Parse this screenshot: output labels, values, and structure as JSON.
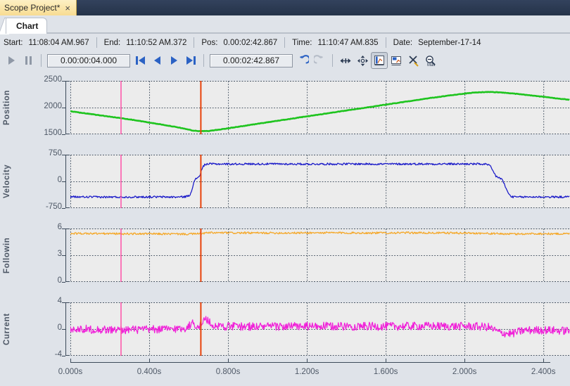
{
  "window": {
    "document_tab": "Scope Project*",
    "close_glyph": "×",
    "chart_tab": "Chart"
  },
  "info": {
    "start_label": "Start:",
    "start_value": "11:08:04 AM.967",
    "end_label": "End:",
    "end_value": "11:10:52 AM.372",
    "pos_label": "Pos:",
    "pos_value": "0.00:02:42.867",
    "time_label": "Time:",
    "time_value": "11:10:47 AM.835",
    "date_label": "Date:",
    "date_value": "September-17-14"
  },
  "toolbar": {
    "play": "play-button",
    "pause": "pause-button",
    "duration_value": "0.00:00:04.000",
    "skip_start": "skip-to-start-button",
    "step_back": "step-back-button",
    "step_forward": "step-forward-button",
    "skip_end": "skip-to-end-button",
    "position_value": "0.00:02:42.867",
    "undo": "undo-button",
    "redo": "redo-button",
    "fit_horizontal": "fit-horizontal-button",
    "pan": "pan-button",
    "cursor_mode_1": "chart-cursor-1-button",
    "cursor_mode_2": "chart-cursor-2-button",
    "clear_cursors": "clear-cursors-button",
    "zoom_max": "zoom-max-button",
    "accent": "#2b62c4"
  },
  "chart_data": {
    "type": "line",
    "title": "Chart",
    "xlabel": "",
    "x_unit": "s",
    "xlim": [
      0.0,
      2.535
    ],
    "xticks": [
      0.0,
      0.4,
      0.8,
      1.2,
      1.6,
      2.0,
      2.4
    ],
    "xticklabels": [
      "0.000s",
      "0.400s",
      "0.800s",
      "1.200s",
      "1.600s",
      "2.000s",
      "2.400s"
    ],
    "grid": true,
    "legend": "none",
    "cursors": [
      {
        "name": "cursor-1",
        "x": 0.257,
        "color": "#ff50a8"
      },
      {
        "name": "cursor-2",
        "x": 0.662,
        "color": "#e8420a"
      }
    ],
    "panels": [
      {
        "name": "position",
        "ylabel": "Position",
        "ylim": [
          1500,
          2500
        ],
        "yticks": [
          1500,
          2000,
          2500
        ],
        "yticklabels": [
          "1500",
          "2000",
          "2500"
        ],
        "color": "#1fc41f",
        "noise": 4,
        "points": [
          [
            0.0,
            1930
          ],
          [
            0.1,
            1880
          ],
          [
            0.2,
            1830
          ],
          [
            0.3,
            1780
          ],
          [
            0.4,
            1720
          ],
          [
            0.5,
            1660
          ],
          [
            0.58,
            1605
          ],
          [
            0.62,
            1570
          ],
          [
            0.66,
            1558
          ],
          [
            0.7,
            1562
          ],
          [
            0.75,
            1585
          ],
          [
            0.85,
            1640
          ],
          [
            1.0,
            1725
          ],
          [
            1.2,
            1835
          ],
          [
            1.4,
            1945
          ],
          [
            1.6,
            2055
          ],
          [
            1.8,
            2165
          ],
          [
            1.95,
            2240
          ],
          [
            2.05,
            2282
          ],
          [
            2.12,
            2292
          ],
          [
            2.18,
            2285
          ],
          [
            2.25,
            2262
          ],
          [
            2.35,
            2222
          ],
          [
            2.45,
            2180
          ],
          [
            2.535,
            2145
          ]
        ]
      },
      {
        "name": "velocity",
        "ylabel": "Velocity",
        "ylim": [
          -750,
          750
        ],
        "yticks": [
          -750,
          0,
          750
        ],
        "yticklabels": [
          "-750",
          "0",
          "750"
        ],
        "color": "#1818c8",
        "noise": 28,
        "points": [
          [
            0.0,
            -435
          ],
          [
            0.2,
            -440
          ],
          [
            0.4,
            -435
          ],
          [
            0.55,
            -440
          ],
          [
            0.58,
            -430
          ],
          [
            0.605,
            -400
          ],
          [
            0.615,
            -250
          ],
          [
            0.625,
            -60
          ],
          [
            0.635,
            60
          ],
          [
            0.645,
            110
          ],
          [
            0.655,
            150
          ],
          [
            0.665,
            300
          ],
          [
            0.675,
            430
          ],
          [
            0.685,
            480
          ],
          [
            0.7,
            490
          ],
          [
            0.8,
            488
          ],
          [
            1.0,
            490
          ],
          [
            1.2,
            487
          ],
          [
            1.4,
            490
          ],
          [
            1.6,
            488
          ],
          [
            1.8,
            490
          ],
          [
            2.0,
            489
          ],
          [
            2.08,
            488
          ],
          [
            2.11,
            480
          ],
          [
            2.13,
            430
          ],
          [
            2.145,
            280
          ],
          [
            2.16,
            140
          ],
          [
            2.175,
            105
          ],
          [
            2.19,
            60
          ],
          [
            2.205,
            -120
          ],
          [
            2.22,
            -320
          ],
          [
            2.235,
            -420
          ],
          [
            2.25,
            -440
          ],
          [
            2.35,
            -435
          ],
          [
            2.45,
            -438
          ],
          [
            2.535,
            -435
          ]
        ]
      },
      {
        "name": "following-error",
        "ylabel": "Followin",
        "ylim": [
          0,
          6
        ],
        "yticks": [
          0,
          3,
          6
        ],
        "yticklabels": [
          "0",
          "3",
          "6"
        ],
        "color": "#f5a623",
        "noise": 0.11,
        "points": [
          [
            0.0,
            5.45
          ],
          [
            0.2,
            5.42
          ],
          [
            0.4,
            5.4
          ],
          [
            0.6,
            5.38
          ],
          [
            0.66,
            5.42
          ],
          [
            0.7,
            5.52
          ],
          [
            0.9,
            5.5
          ],
          [
            1.1,
            5.5
          ],
          [
            1.3,
            5.52
          ],
          [
            1.5,
            5.5
          ],
          [
            1.7,
            5.52
          ],
          [
            1.9,
            5.5
          ],
          [
            2.05,
            5.48
          ],
          [
            2.15,
            5.42
          ],
          [
            2.25,
            5.38
          ],
          [
            2.35,
            5.42
          ],
          [
            2.45,
            5.4
          ],
          [
            2.535,
            5.42
          ]
        ]
      },
      {
        "name": "current",
        "ylabel": "Current",
        "ylim": [
          -4,
          4
        ],
        "yticks": [
          -4,
          0,
          4
        ],
        "yticklabels": [
          "-4",
          "0",
          "4"
        ],
        "color": "#f020d8",
        "noise": 0.62,
        "points": [
          [
            0.0,
            0.1
          ],
          [
            0.1,
            -0.05
          ],
          [
            0.2,
            -0.12
          ],
          [
            0.3,
            -0.1
          ],
          [
            0.4,
            -0.08
          ],
          [
            0.5,
            0.0
          ],
          [
            0.58,
            0.1
          ],
          [
            0.62,
            0.85
          ],
          [
            0.655,
            0.4
          ],
          [
            0.685,
            1.6
          ],
          [
            0.72,
            0.55
          ],
          [
            0.8,
            0.4
          ],
          [
            1.0,
            0.38
          ],
          [
            1.2,
            0.4
          ],
          [
            1.4,
            0.42
          ],
          [
            1.6,
            0.4
          ],
          [
            1.8,
            0.45
          ],
          [
            1.95,
            0.42
          ],
          [
            2.05,
            0.4
          ],
          [
            2.12,
            0.3
          ],
          [
            2.18,
            -0.55
          ],
          [
            2.24,
            -0.7
          ],
          [
            2.3,
            -0.2
          ],
          [
            2.4,
            -0.15
          ],
          [
            2.5,
            -0.25
          ],
          [
            2.535,
            -0.2
          ]
        ]
      }
    ]
  }
}
